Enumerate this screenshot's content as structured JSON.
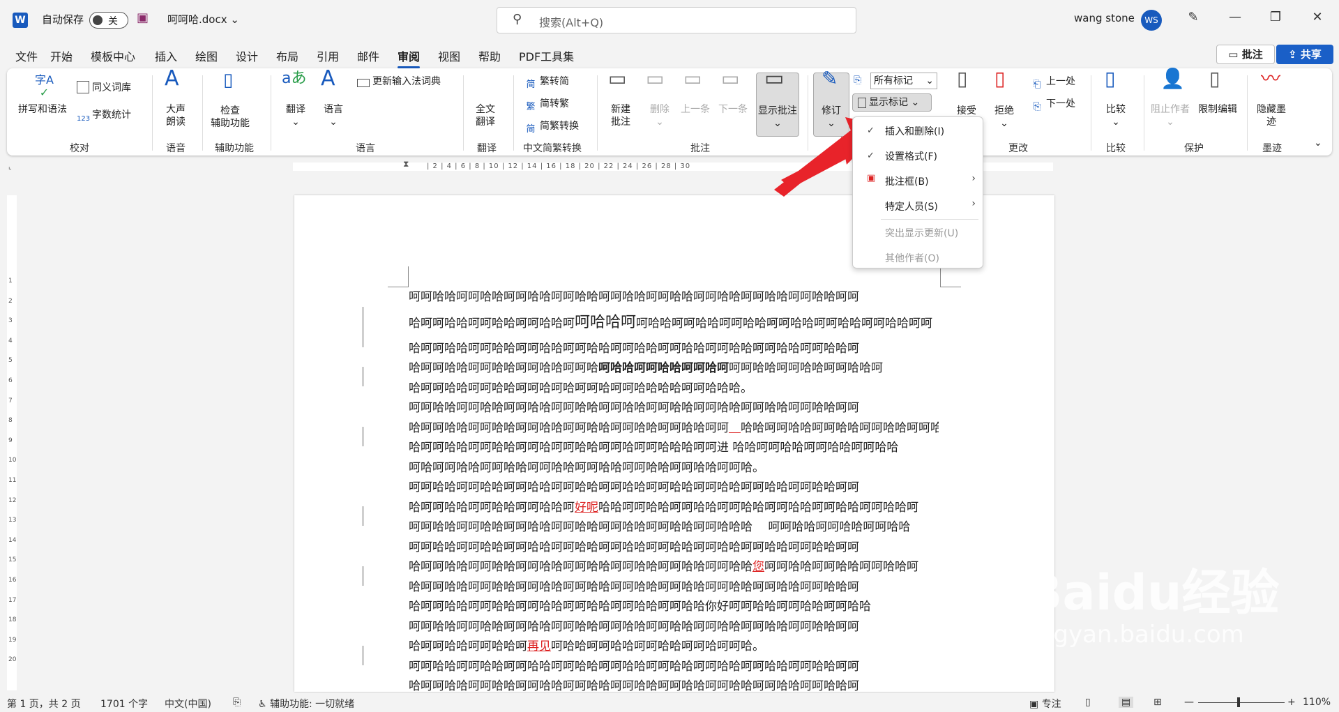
{
  "title_bar": {
    "autosave_label": "自动保存",
    "autosave_state": "关",
    "filename": "呵呵哈.docx",
    "search_placeholder": "搜索(Alt+Q)",
    "user_name": "wang stone",
    "user_initials": "WS"
  },
  "menu": {
    "tabs": [
      "文件",
      "开始",
      "模板中心",
      "插入",
      "绘图",
      "设计",
      "布局",
      "引用",
      "邮件",
      "审阅",
      "视图",
      "帮助",
      "PDF工具集"
    ],
    "active": "审阅",
    "comment_button": "批注",
    "share_button": "共享"
  },
  "ribbon": {
    "proofing": {
      "spelling": "拼写和语法",
      "thesaurus": "同义词库",
      "word_count": "字数统计",
      "group": "校对"
    },
    "speech": {
      "read_aloud": "大声\n朗读",
      "group": "语音"
    },
    "accessibility": {
      "check": "检查\n辅助功能",
      "group": "辅助功能"
    },
    "language": {
      "translate": "翻译",
      "language": "语言",
      "update_ime": "更新输入法词典",
      "group": "语言"
    },
    "translation": {
      "full_translate": "全文\n翻译",
      "group": "翻译"
    },
    "chinese_conversion": {
      "trad_to_simp": "繁转简",
      "simp_to_trad": "简转繁",
      "convert": "简繁转换",
      "group": "中文简繁转换"
    },
    "comments": {
      "new": "新建\n批注",
      "delete": "删除",
      "prev": "上一条",
      "next": "下一条",
      "show": "显示批注",
      "group": "批注"
    },
    "tracking": {
      "track_changes": "修订",
      "all_markup": "所有标记",
      "show_markup": "显示标记"
    },
    "changes": {
      "accept": "接受",
      "reject": "拒绝",
      "prev": "上一处",
      "next": "下一处",
      "group": "更改"
    },
    "compare": {
      "compare": "比较",
      "group": "比较"
    },
    "protect": {
      "block_authors": "阻止作者",
      "restrict": "限制编辑",
      "group": "保护"
    },
    "ink": {
      "hide_ink": "隐藏墨\n迹",
      "group": "墨迹"
    }
  },
  "ruler_ticks": "| 2 |  4 |  6 |  8 | 10 | 12 | 14 | 16 | 18 | 20 | 22 | 24 | 26 | 28 | 30",
  "dropdown": {
    "items": [
      {
        "label": "插入和删除(I)",
        "checked": true,
        "submenu": false,
        "disabled": false
      },
      {
        "label": "设置格式(F)",
        "checked": true,
        "submenu": false,
        "disabled": false
      },
      {
        "label": "批注框(B)",
        "checked": false,
        "submenu": true,
        "disabled": false
      },
      {
        "label": "特定人员(S)",
        "checked": false,
        "submenu": true,
        "disabled": false
      },
      {
        "label": "突出显示更新(U)",
        "checked": false,
        "submenu": false,
        "disabled": true
      },
      {
        "label": "其他作者(O)",
        "checked": false,
        "submenu": false,
        "disabled": true
      }
    ]
  },
  "document": {
    "line1": "呵呵哈哈呵呵哈哈呵呵哈哈呵呵哈哈呵呵哈哈呵呵哈哈呵呵哈哈呵呵哈哈呵呵哈哈呵呵",
    "line2a": "哈呵呵哈哈呵呵哈哈呵呵哈哈呵",
    "line2big": "呵哈哈呵",
    "line2b": "呵哈哈呵呵哈哈呵呵哈哈呵呵哈哈呵呵哈哈呵呵哈哈呵呵",
    "line3": "哈呵呵哈哈呵呵哈哈呵呵哈哈呵呵哈哈呵呵哈哈呵呵哈哈呵呵哈哈呵呵哈哈呵呵哈哈呵",
    "line4a": "哈呵呵哈哈呵呵哈哈呵呵哈哈呵呵哈",
    "line4bold": "呵哈哈呵呵哈哈呵呵哈呵",
    "line4b": "呵呵哈哈呵呵哈哈呵呵哈哈呵",
    "line5": "哈呵呵哈哈呵呵哈哈呵呵哈呵哈呵呵哈呵呵哈哈哈哈呵呵哈哈哈。",
    "line6": "呵呵哈哈呵呵哈哈呵呵哈哈呵呵哈哈呵呵哈哈呵呵哈哈呵呵哈哈呵呵哈哈呵呵哈哈呵呵",
    "line7a": "哈呵呵哈哈呵呵哈哈呵呵哈哈呵呵哈哈呵呵哈哈呵呵哈哈呵呵",
    "line7b": "哈哈呵呵哈哈呵呵哈哈呵呵哈哈呵呵哈哈呵",
    "line8": "哈呵呵哈哈呵呵哈哈呵呵哈呵呵哈哈呵呵哈呵呵哈哈哈呵呵进 哈哈呵呵哈哈呵呵哈哈呵呵哈哈",
    "line9": "呵哈呵呵哈哈呵呵哈哈呵呵哈哈呵呵哈哈呵呵哈哈呵呵哈哈呵呵哈。",
    "line10": "呵呵哈哈呵呵哈哈呵呵哈哈呵呵哈哈呵呵哈哈呵呵哈哈呵呵哈哈呵呵哈哈呵呵哈哈呵呵",
    "line11a": "哈呵呵哈哈呵呵哈哈呵呵哈哈呵",
    "line11ins": "好呢",
    "line11b": "哈哈呵呵哈哈呵呵哈哈呵呵哈哈呵呵哈哈呵呵哈哈呵呵哈哈呵",
    "line12": "呵呵哈哈呵呵哈哈呵呵哈哈呵呵哈哈呵呵哈哈呵呵哈哈呵呵哈哈哈　 呵呵哈哈呵呵哈哈呵呵哈哈",
    "line13": "呵呵哈哈呵呵哈哈呵呵哈哈呵呵哈哈呵呵哈哈呵呵哈哈呵呵哈哈呵呵哈哈呵呵哈哈呵呵",
    "line14a": "哈呵呵哈哈呵呵哈哈呵呵哈哈呵呵哈哈呵呵哈哈呵呵哈哈呵呵哈哈",
    "line14ins": "您",
    "line14b": "呵呵哈哈呵呵哈哈呵呵哈哈呵",
    "line15": "哈呵呵哈哈呵呵哈哈呵呵哈哈呵呵哈哈呵呵哈哈呵呵哈哈呵呵哈哈呵呵哈哈呵呵哈哈呵",
    "line16": "哈呵呵哈哈呵呵哈哈呵呵哈哈呵呵哈哈呵呵哈哈呵呵哈哈你好呵呵哈哈呵呵哈哈呵呵哈哈",
    "line17": "呵呵哈哈呵呵哈哈呵呵哈哈呵呵哈哈呵呵哈哈呵呵哈哈呵呵哈哈呵呵哈哈呵呵哈哈呵呵",
    "line18a": "哈呵呵哈哈呵呵哈哈呵",
    "line18ins": "再见",
    "line18b": "呵哈哈呵呵哈哈呵呵哈哈呵呵哈呵呵哈。",
    "line19": "呵呵哈哈呵呵哈哈呵呵哈哈呵呵哈哈呵呵哈哈呵呵哈哈呵呵哈哈呵呵哈哈呵呵哈哈呵呵",
    "line20": "哈呵呵哈哈呵呵哈哈呵呵哈哈呵呵哈哈呵呵哈哈呵呵哈哈呵呵哈哈呵呵哈哈呵呵哈哈呵"
  },
  "status_bar": {
    "page": "第 1 页，共 2 页",
    "words": "1701 个字",
    "language": "中文(中国)",
    "accessibility": "辅助功能: 一切就绪",
    "focus": "专注",
    "zoom": "110%"
  },
  "watermark": {
    "brand": "Baidu经验",
    "url": "jingyan.baidu.com"
  },
  "colors": {
    "accent": "#185abd",
    "insert": "#d22222",
    "arrow": "#e8232a"
  }
}
